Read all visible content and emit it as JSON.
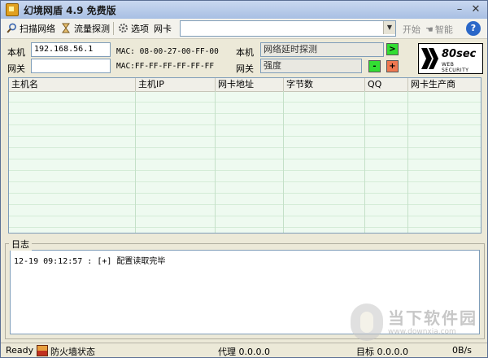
{
  "window": {
    "title": "幻境网盾 4.9 免费版"
  },
  "toolbar": {
    "scan_label": "扫描网络",
    "traffic_label": "流量探测",
    "options_label": "选项",
    "nic_label": "网卡",
    "start_label": "开始",
    "smart_label": "智能"
  },
  "info": {
    "local_label": "本机",
    "local_ip": "192.168.56.1",
    "local_mac": "MAC: 08-00-27-00-FF-00",
    "gateway_label": "网关",
    "gateway_ip": "",
    "gateway_mac": "MAC:FF-FF-FF-FF-FF-FF",
    "local_right_label": "本机",
    "latency_probe": "网络延时探测",
    "gateway_right_label": "网关",
    "strength_label": "强度",
    "go_button": ">",
    "minus_button": "-",
    "plus_button": "+",
    "logo_main": "80sec",
    "logo_sub": "WEB SECURITY"
  },
  "table": {
    "columns": [
      "主机名",
      "主机IP",
      "网卡地址",
      "字节数",
      "QQ",
      "网卡生产商"
    ]
  },
  "log": {
    "title": "日志",
    "lines": [
      "12-19 09:12:57 : [+] 配置读取完毕"
    ]
  },
  "statusbar": {
    "ready": "Ready",
    "firewall": "防火墙状态",
    "proxy": "代理 0.0.0.0",
    "target": "目标 0.0.0.0",
    "rate": "0B/s"
  },
  "watermark": {
    "text": "当下软件园",
    "url": "www.downxia.com"
  },
  "colors": {
    "table_bg": "#eefaf0",
    "go_green": "#33dd33",
    "plus_orange": "#f07850",
    "help_blue": "#2a67c8"
  }
}
